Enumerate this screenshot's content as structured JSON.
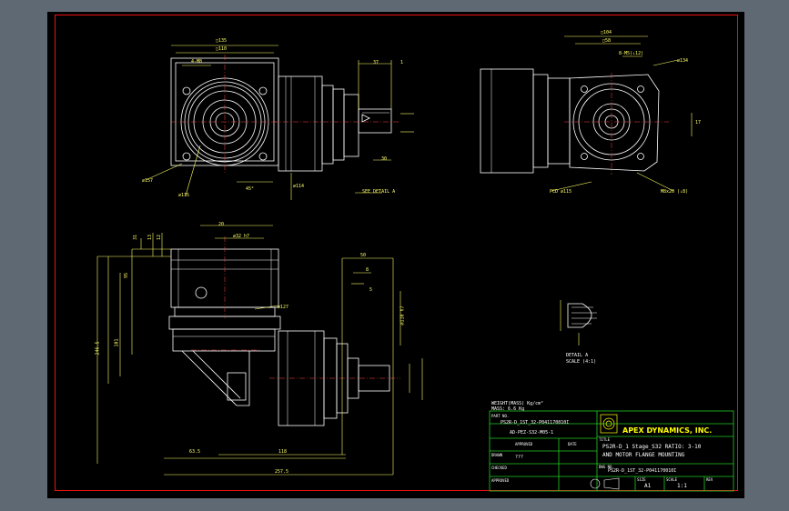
{
  "colors": {
    "background": "#5f6974",
    "canvas": "#000000",
    "frame": "#e11111",
    "lines": "#ffffff",
    "dims": "#ffff66",
    "titleblock": "#22cc22",
    "logo": "#ffff00"
  },
  "notes": {
    "weight": "WEIGHT(MASS) Kg/cm²",
    "mass": "MASS: 6.6 Kg"
  },
  "titleblock": {
    "part_no_label": "PART NO.",
    "part_no_1": "PS2R-D_1ST_32-P041170010I",
    "part_no_2": "AD-PEZ-S32-M05-1",
    "approved_label": "APPROVED",
    "date_label": "DATE",
    "drawn_label": "DRAWN",
    "drawn_value": "???",
    "checked_label": "CHECKED",
    "approved2_label": "APPROVED",
    "company": "APEX DYNAMICS, INC.",
    "title_label": "TITLE",
    "title_1": "PS2R-D_1 Stage_S32   RATIO: 3-10",
    "title_2": "AND MOTOR FLANGE MOUNTING",
    "dwg_label": "DWG NO.",
    "dwg_no": "PS2R-D_1ST_32-P041170010I",
    "size_label": "SIZE",
    "size": "A1",
    "scale_label": "SCALE",
    "scale": "1:1",
    "rev_label": "REV"
  },
  "detail": {
    "label": "DETAIL A",
    "scale": "SCALE (4:1)"
  },
  "dims": {
    "top_left_1": "□135",
    "top_left_2": "□110",
    "top_left_3": "4-M8",
    "dia_157": "⌀157",
    "dia_115": "⌀115",
    "dia_114": "⌀114",
    "angle_45": "45°",
    "see_detail": "SEE DETAIL A",
    "d37": "37",
    "d1": "1",
    "top_right_1": "□104",
    "top_right_2": "□58",
    "top_right_3": "8-M5(↓12)",
    "dia_134": "⌀134",
    "pcd": "PCD ⌀115",
    "m8": "M8x20 (↓8)",
    "d17": "17",
    "dim_2465": "246.5",
    "dim_101": "101",
    "dim_31": "31",
    "dim_8": "8",
    "dim_5": "5",
    "dia_32": "⌀32 h7",
    "dia_127": "⌀127",
    "dia_110": "⌀110 h7",
    "dim_30": "30",
    "dim_95": "95",
    "dim_635": "63.5",
    "dim_118": "118",
    "dim_2575": "257.5",
    "dim_12": "12",
    "dim_13": "13",
    "dim_20": "20",
    "dim_50": "50"
  }
}
